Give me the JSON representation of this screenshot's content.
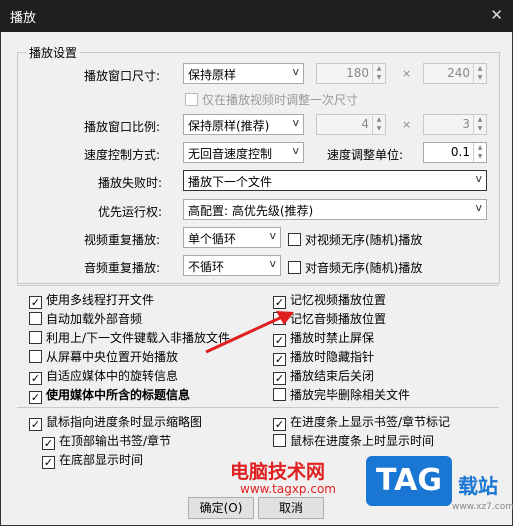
{
  "window": {
    "title": "播放",
    "close_glyph": "✕"
  },
  "group": {
    "title": "播放设置"
  },
  "size_row": {
    "label": "播放窗口尺寸:",
    "combo": "保持原样",
    "w": "180",
    "h": "240",
    "times": "×",
    "only_once": "仅在播放视频时调整一次尺寸"
  },
  "ratio_row": {
    "label": "播放窗口比例:",
    "combo": "保持原样(推荐)",
    "a": "4",
    "b": "3",
    "times": "×"
  },
  "speed_row": {
    "label": "速度控制方式:",
    "combo": "无回音速度控制",
    "unit_label": "速度调整单位:",
    "unit_value": "0.1"
  },
  "fail_row": {
    "label": "播放失败时:",
    "combo": "播放下一个文件"
  },
  "priority_row": {
    "label": "优先运行权:",
    "combo": "高配置: 高优先级(推荐)"
  },
  "video_repeat": {
    "label": "视频重复播放:",
    "combo": "单个循环",
    "random": "对视频无序(随机)播放"
  },
  "audio_repeat": {
    "label": "音频重复播放:",
    "combo": "不循环",
    "random": "对音频无序(随机)播放"
  },
  "options_left": [
    {
      "label": "使用多线程打开文件",
      "checked": true
    },
    {
      "label": "自动加载外部音频",
      "checked": false
    },
    {
      "label": "利用上/下一文件键载入非播放文件",
      "checked": false
    },
    {
      "label": "从屏幕中央位置开始播放",
      "checked": false
    },
    {
      "label": "自适应媒体中的旋转信息",
      "checked": true
    },
    {
      "label": "使用媒体中所含的标题信息",
      "checked": true
    }
  ],
  "options_right": [
    {
      "label": "记忆视频播放位置",
      "checked": true
    },
    {
      "label": "记忆音频播放位置",
      "checked": false
    },
    {
      "label": "播放时禁止屏保",
      "checked": true
    },
    {
      "label": "播放时隐藏指针",
      "checked": true
    },
    {
      "label": "播放结束后关闭",
      "checked": true
    },
    {
      "label": "播放完毕删除相关文件",
      "checked": false
    }
  ],
  "seek_left": [
    {
      "label": "鼠标指向进度条时显示缩略图",
      "checked": true
    },
    {
      "label": "在顶部输出书签/章节",
      "checked": true
    },
    {
      "label": "在底部显示时间",
      "checked": true
    }
  ],
  "seek_right": [
    {
      "label": "在进度条上显示书签/章节标记",
      "checked": true
    },
    {
      "label": "鼠标在进度条上时显示时间",
      "checked": false
    }
  ],
  "buttons": {
    "ok": "确定(O)",
    "cancel": "取消"
  },
  "watermark": {
    "site": "电脑技术网",
    "url": "www.tagxp.com",
    "tag": "TAG",
    "tag_side": "载站",
    "tag_url": "www.xz7.com"
  },
  "colors": {
    "titlebar": "#1f1f1f",
    "dialog_bg": "#f0f0f0",
    "arrow": "#e02020",
    "tag_blue": "#1976d2"
  }
}
